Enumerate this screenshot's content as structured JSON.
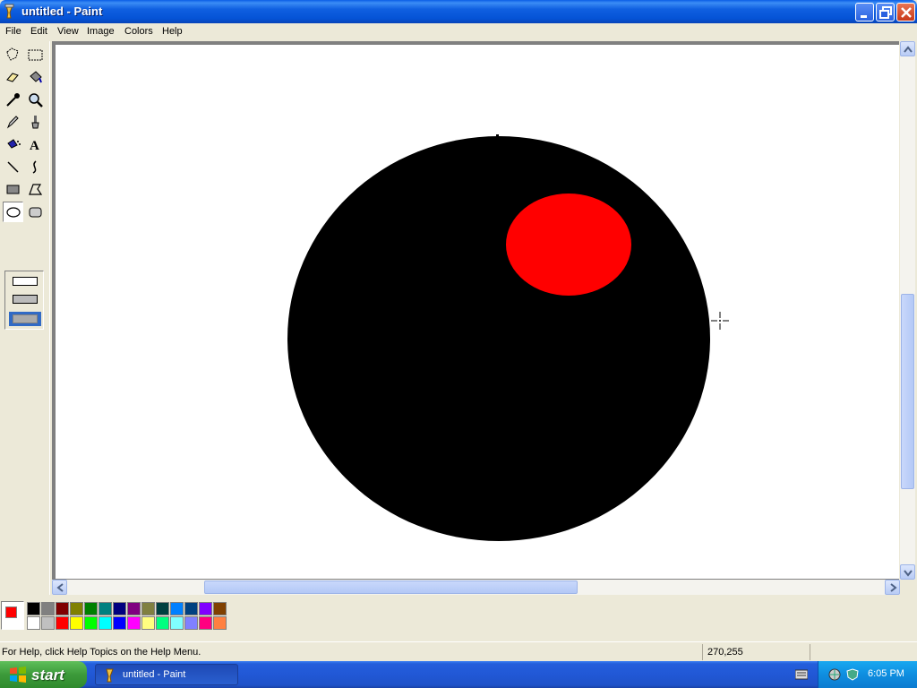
{
  "window": {
    "title": "untitled - Paint"
  },
  "menu": {
    "items": [
      "File",
      "Edit",
      "View",
      "Image",
      "Colors",
      "Help"
    ]
  },
  "toolbox": {
    "tools": [
      "free-form-select",
      "select",
      "eraser",
      "fill-with-color",
      "pick-color",
      "magnifier",
      "pencil",
      "brush",
      "airbrush",
      "text",
      "line",
      "curve",
      "rectangle",
      "polygon",
      "ellipse",
      "rounded-rectangle"
    ],
    "selected_tool": "ellipse"
  },
  "canvas": {
    "shapes": [
      {
        "type": "ellipse",
        "fill": "#000000"
      },
      {
        "type": "ellipse",
        "fill": "#ff0000"
      }
    ]
  },
  "palette": {
    "foreground": "#ff0000",
    "background": "#ffffff",
    "top_row": [
      "#000000",
      "#808080",
      "#800000",
      "#808000",
      "#008000",
      "#008080",
      "#000080",
      "#800080",
      "#808040",
      "#004040",
      "#0080ff",
      "#004080",
      "#8000ff",
      "#804000"
    ],
    "bottom_row": [
      "#ffffff",
      "#c0c0c0",
      "#ff0000",
      "#ffff00",
      "#00ff00",
      "#00ffff",
      "#0000ff",
      "#ff00ff",
      "#ffff80",
      "#00ff80",
      "#80ffff",
      "#8080ff",
      "#ff0080",
      "#ff8040"
    ]
  },
  "status": {
    "help_text": "For Help, click Help Topics on the Help Menu.",
    "coords": "270,255"
  },
  "taskbar": {
    "start_label": "start",
    "task_label": "untitled - Paint",
    "clock": "6:05 PM"
  }
}
